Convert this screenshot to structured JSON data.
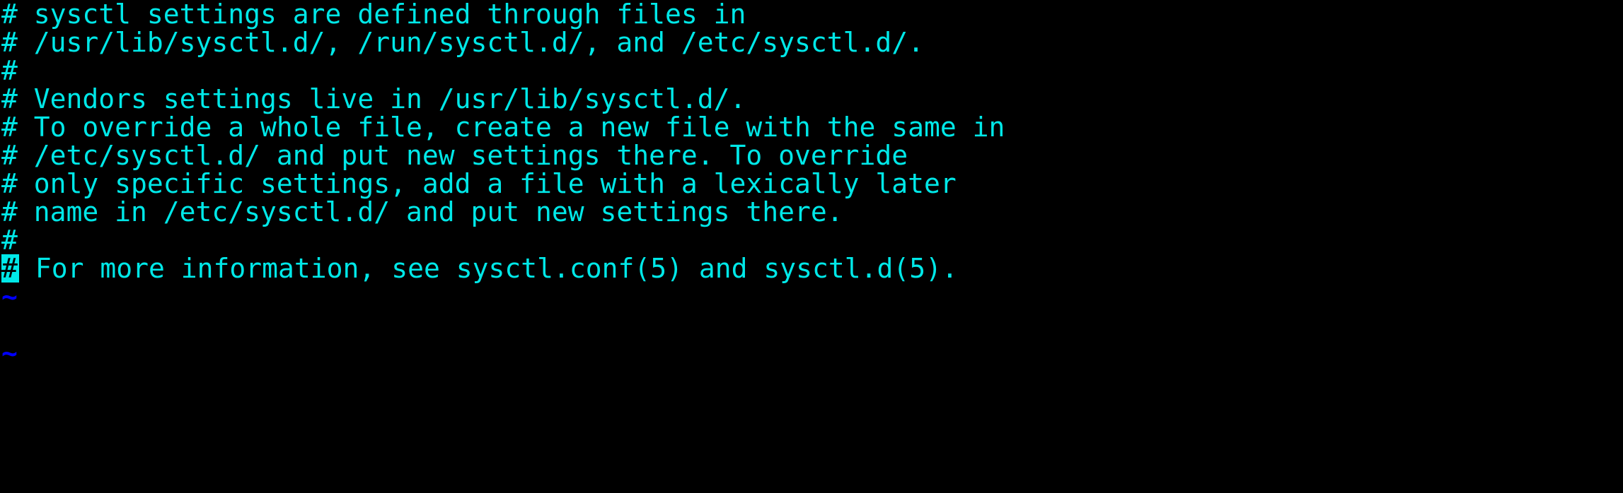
{
  "terminal": {
    "app": "vim",
    "colors": {
      "background": "#000000",
      "foreground": "#00e8e8",
      "comment": "#00e8e8",
      "tilde": "#0000ff",
      "cursor_background": "#00e8e8",
      "cursor_foreground": "#000000"
    },
    "cursor": {
      "line_index": 9,
      "column": 0,
      "character": "#"
    }
  },
  "buffer": {
    "lines": [
      {
        "type": "comment",
        "text": "# sysctl settings are defined through files in"
      },
      {
        "type": "comment",
        "text": "# /usr/lib/sysctl.d/, /run/sysctl.d/, and /etc/sysctl.d/."
      },
      {
        "type": "comment",
        "text": "#"
      },
      {
        "type": "comment",
        "text": "# Vendors settings live in /usr/lib/sysctl.d/."
      },
      {
        "type": "comment",
        "text": "# To override a whole file, create a new file with the same in"
      },
      {
        "type": "comment",
        "text": "# /etc/sysctl.d/ and put new settings there. To override"
      },
      {
        "type": "comment",
        "text": "# only specific settings, add a file with a lexically later"
      },
      {
        "type": "comment",
        "text": "# name in /etc/sysctl.d/ and put new settings there."
      },
      {
        "type": "comment",
        "text": "#"
      },
      {
        "type": "comment-cursor",
        "cursor_char": "#",
        "text": " For more information, see sysctl.conf(5) and sysctl.d(5)."
      },
      {
        "type": "tilde",
        "text": "~"
      },
      {
        "type": "blank",
        "text": ""
      },
      {
        "type": "tilde",
        "text": "~"
      },
      {
        "type": "blank",
        "text": ""
      },
      {
        "type": "blank",
        "text": ""
      },
      {
        "type": "blank",
        "text": ""
      },
      {
        "type": "blank",
        "text": ""
      }
    ]
  }
}
